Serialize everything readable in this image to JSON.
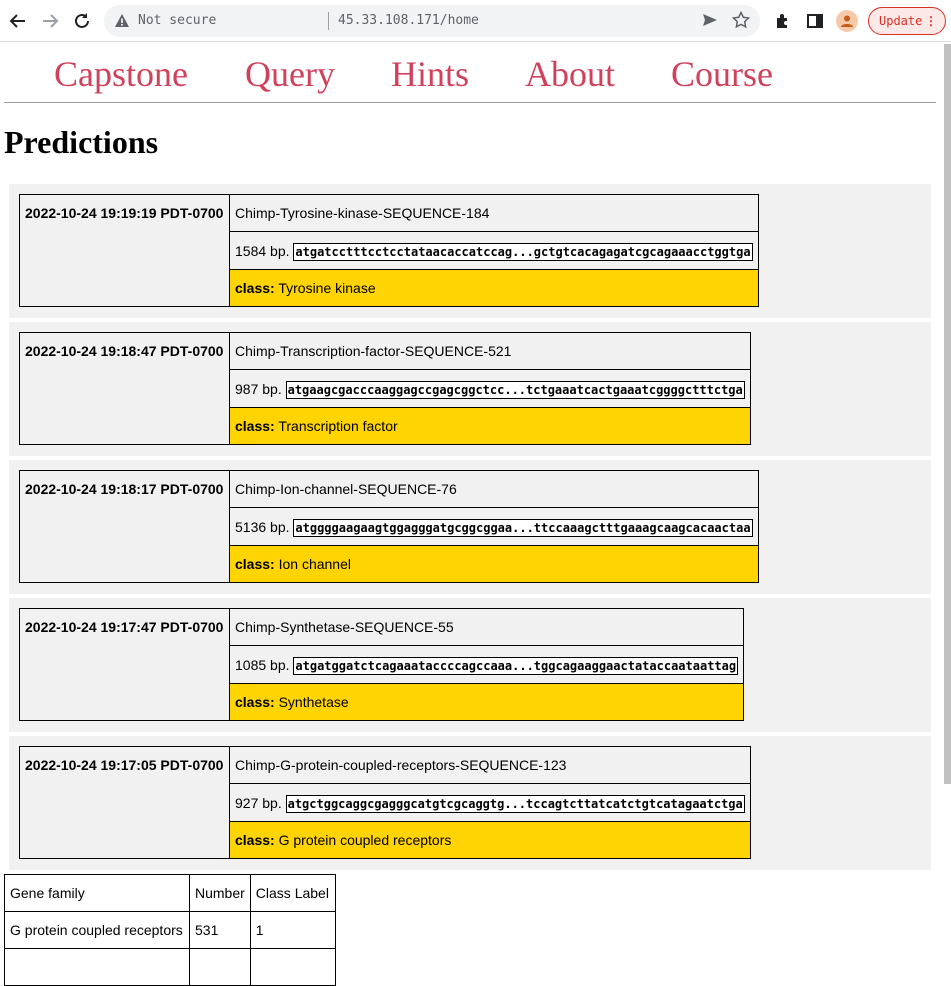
{
  "browser": {
    "not_secure": "Not secure",
    "url": "45.33.108.171/home",
    "update_label": "Update",
    "update_dots": "⋮"
  },
  "nav": {
    "capstone": "Capstone",
    "query": "Query",
    "hints": "Hints",
    "about": "About",
    "course": "Course"
  },
  "page_title": "Predictions",
  "predictions": [
    {
      "timestamp": "2022-10-24 19:19:19 PDT-0700",
      "name": "Chimp-Tyrosine-kinase-SEQUENCE-184",
      "length": "1584 bp.",
      "sequence": "atgatcctttcctcctataacaccatccag...gctgtcacagagatcgcagaaacctggtga",
      "class_label": "class:",
      "class_value": "Tyrosine kinase"
    },
    {
      "timestamp": "2022-10-24 19:18:47 PDT-0700",
      "name": "Chimp-Transcription-factor-SEQUENCE-521",
      "length": "987 bp.",
      "sequence": "atgaagcgacccaaggagccgagcggctcc...tctgaaatcactgaaatcggggctttctga",
      "class_label": "class:",
      "class_value": "Transcription factor"
    },
    {
      "timestamp": "2022-10-24 19:18:17 PDT-0700",
      "name": "Chimp-Ion-channel-SEQUENCE-76",
      "length": "5136 bp.",
      "sequence": "atggggaagaagtggagggatgcggcggaa...ttccaaagctttgaaagcaagcacaactaa",
      "class_label": "class:",
      "class_value": "Ion channel"
    },
    {
      "timestamp": "2022-10-24 19:17:47 PDT-0700",
      "name": "Chimp-Synthetase-SEQUENCE-55",
      "length": "1085 bp.",
      "sequence": "atgatggatctcagaaataccccagccaaa...tggcagaaggaactataccaataattag",
      "class_label": "class:",
      "class_value": "Synthetase"
    },
    {
      "timestamp": "2022-10-24 19:17:05 PDT-0700",
      "name": "Chimp-G-protein-coupled-receptors-SEQUENCE-123",
      "length": "927 bp.",
      "sequence": "atgctggcaggcgagggcatgtcgcaggtg...tccagtcttatcatctgtcatagaatctga",
      "class_label": "class:",
      "class_value": "G protein coupled receptors"
    }
  ],
  "summary": {
    "headers": [
      "Gene family",
      "Number",
      "Class Label"
    ],
    "rows": [
      [
        "G protein coupled receptors",
        "531",
        "1"
      ]
    ]
  }
}
